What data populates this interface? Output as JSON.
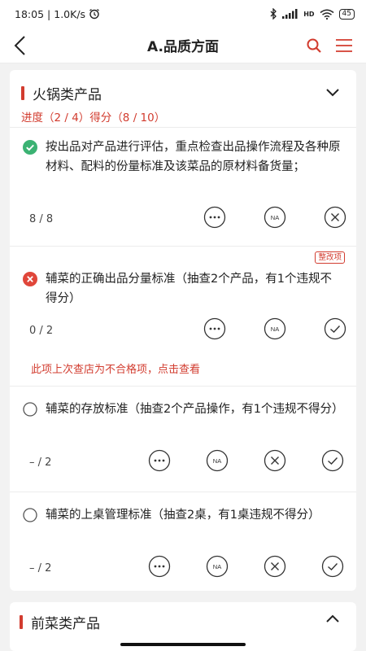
{
  "status": {
    "time": "18:05",
    "speed": "1.0K/s",
    "battery": "45",
    "hd": "HD"
  },
  "nav": {
    "title": "A.品质方面"
  },
  "section1": {
    "title": "火锅类产品",
    "progress": "进度（2 / 4）得分（8 / 10）",
    "items": [
      {
        "status": "pass",
        "text": "按出品对产品进行评估，重点检查出品操作流程及各种原材料、配料的份量标准及该菜品的原材料备货量；",
        "score": "8 / 8"
      },
      {
        "status": "fail",
        "tag": "整改项",
        "text": "辅菜的正确出品分量标准（抽查2个产品，有1个违规不得分）",
        "score": "0 / 2",
        "warning": "此项上次查店为不合格项，点击查看"
      },
      {
        "status": "pending",
        "text": "辅菜的存放标准（抽查2个产品操作，有1个违规不得分）",
        "score": "– / 2"
      },
      {
        "status": "pending",
        "text": "辅菜的上桌管理标准（抽查2桌，有1桌违规不得分）",
        "score": "– / 2"
      }
    ]
  },
  "section2": {
    "title": "前菜类产品"
  },
  "icons": {
    "na": "NA"
  },
  "colors": {
    "accent": "#d23c2f",
    "pass": "#3bb273",
    "fail": "#e0463a"
  }
}
